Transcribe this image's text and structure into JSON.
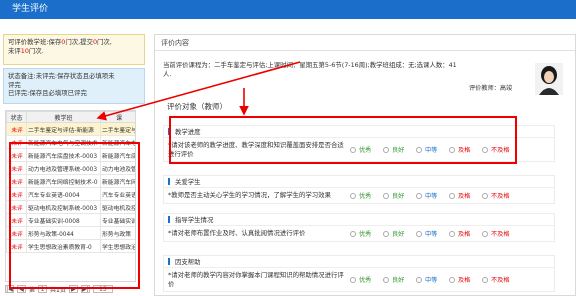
{
  "header": {
    "title": "学生评价"
  },
  "summary": {
    "prefix": "可评价教学班:保存",
    "saved": "0",
    "mid": "门次,提交",
    "submitted": "0",
    "mid2": "门次,",
    "line2a": "未评",
    "unrated": "10",
    "line2b": "门次."
  },
  "note": {
    "l1": "状态备注:未评完:保存状态且必填项未",
    "l2": "评完",
    "l3": "已评完:保存且必填项已评完"
  },
  "table": {
    "headers": [
      "状态",
      "教学班",
      "课"
    ],
    "rows": [
      {
        "status": "未评",
        "class": "二手车鉴定与评估-新能源",
        "course": "二手车鉴定与评"
      },
      {
        "status": "未评",
        "class": "新能源汽车电气与空调技术",
        "course": "新能源汽车电气"
      },
      {
        "status": "未评",
        "class": "新能源汽车底盘技术-0003",
        "course": "新能源汽车底盘"
      },
      {
        "status": "未评",
        "class": "动力电池及管理系统-0003",
        "course": "动力电池及管理"
      },
      {
        "status": "未评",
        "class": "新能源汽车网络控制技术-0",
        "course": "新能源汽车网络"
      },
      {
        "status": "未评",
        "class": "汽车专业英语-0004",
        "course": "汽车专业英语"
      },
      {
        "status": "未评",
        "class": "驱动电机及控制系统-0003",
        "course": "驱动电机及控制"
      },
      {
        "status": "未评",
        "class": "专业基础实训-0008",
        "course": "专业基础实训"
      },
      {
        "status": "未评",
        "class": "形势与政策-0044",
        "course": "形势与政策"
      },
      {
        "status": "未评",
        "class": "学生思想政治素质教育-0",
        "course": "学生思想政治"
      }
    ]
  },
  "pager": {
    "first": "|◀",
    "prev": "◀",
    "page_pre": "第",
    "page": "1",
    "of": "共1页",
    "next": "▶",
    "last": "▶|",
    "size": "15"
  },
  "panel": {
    "title": "评价内容",
    "info": "当前评价课程为：二手车鉴定与评估;上课时间：星期五第5-6节(7-16周);教学班组成：无;选课人数：41人.",
    "teacher": "评价教师：高竣",
    "eval_heading": "评价对象（教师）"
  },
  "options": [
    "优秀",
    "良好",
    "中等",
    "及格",
    "不及格"
  ],
  "colors": {
    "header": "#1b6fca",
    "red": "#e60000"
  },
  "sections": [
    {
      "title": "教学进度",
      "question": "*请对该老师的教学进度、教学深度和知识覆盖面安排是否合适进行评价"
    },
    {
      "title": "关爱学生",
      "question": "*教师是否主动关心学生的学习情况，了解学生的学习效果"
    },
    {
      "title": "指导学生情况",
      "question": "*请对老师布置作业及时、认真批阅情况进行评价"
    },
    {
      "title": "因支帮助",
      "question": "*请对老师的教学内容对你掌握本门课程知识的帮助情况进行评价"
    }
  ]
}
